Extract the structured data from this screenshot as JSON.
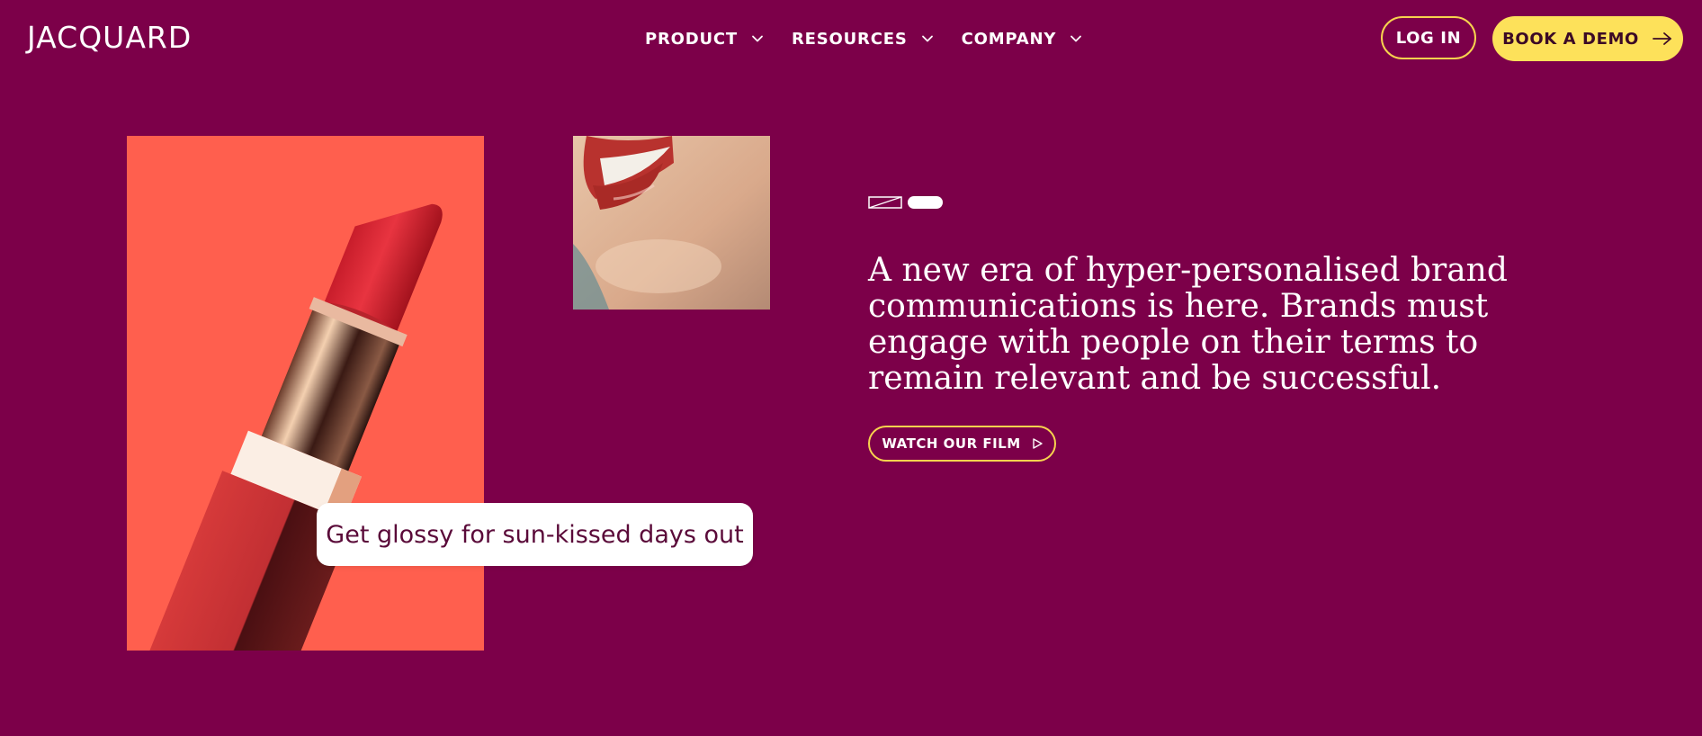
{
  "brand": {
    "name": "JACQUARD"
  },
  "nav": {
    "items": [
      {
        "label": "PRODUCT"
      },
      {
        "label": "RESOURCES"
      },
      {
        "label": "COMPANY"
      }
    ]
  },
  "header_actions": {
    "login_label": "LOG IN",
    "demo_label": "BOOK A DEMO"
  },
  "hero": {
    "caption": "Get glossy for sun-kissed days out",
    "headline": "A new era of hyper-personalised brand communications is here. Brands must engage with people on their terms to remain relevant and be successful.",
    "film_button_label": "WATCH OUR FILM",
    "slider": {
      "total": 2,
      "active_index": 1
    }
  },
  "colors": {
    "background": "#7c0049",
    "accent_yellow": "#fde15a",
    "button_border": "#f7d34e",
    "lipstick_bg": "#ff5f4e",
    "caption_text": "#5a0a39",
    "text": "#ffffff"
  },
  "icons": {
    "nav_chevron": "chevron-down-icon",
    "demo_arrow": "arrow-right-icon",
    "film_play": "play-icon"
  }
}
